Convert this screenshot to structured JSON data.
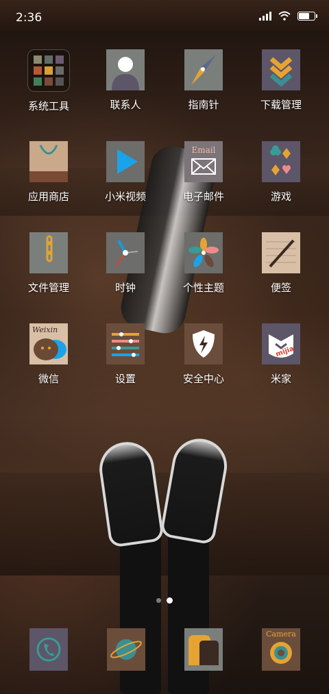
{
  "status_bar": {
    "time": "2:36"
  },
  "apps": [
    {
      "label": "系统工具",
      "icon": "folder-icon"
    },
    {
      "label": "联系人",
      "icon": "contacts-icon"
    },
    {
      "label": "指南针",
      "icon": "compass-icon"
    },
    {
      "label": "下载管理",
      "icon": "download-icon"
    },
    {
      "label": "应用商店",
      "icon": "store-bag-icon"
    },
    {
      "label": "小米视频",
      "icon": "video-play-icon"
    },
    {
      "label": "电子邮件",
      "icon": "email-icon",
      "icon_text": "Email"
    },
    {
      "label": "游戏",
      "icon": "cards-suit-icon"
    },
    {
      "label": "文件管理",
      "icon": "file-manager-icon"
    },
    {
      "label": "时钟",
      "icon": "clock-icon"
    },
    {
      "label": "个性主题",
      "icon": "pinwheel-icon"
    },
    {
      "label": "便签",
      "icon": "notes-pen-icon"
    },
    {
      "label": "微信",
      "icon": "wechat-icon",
      "icon_text": "Weixin"
    },
    {
      "label": "设置",
      "icon": "settings-sliders-icon"
    },
    {
      "label": "安全中心",
      "icon": "security-shield-icon"
    },
    {
      "label": "米家",
      "icon": "mijia-icon",
      "icon_text": "mijia"
    }
  ],
  "dock": [
    {
      "name": "phone",
      "icon": "phone-icon"
    },
    {
      "name": "browser",
      "icon": "planet-icon"
    },
    {
      "name": "gallery",
      "icon": "gallery-icon"
    },
    {
      "name": "camera",
      "icon": "camera-icon",
      "icon_text": "Camera"
    }
  ],
  "page_indicator": {
    "pages": 2,
    "active": 2
  },
  "colors": {
    "icon_gray": "#7b7f7c",
    "icon_purple": "#5d5568",
    "icon_brown": "#6b4d3c",
    "accent_blue": "#1aa3e8",
    "accent_teal": "#3a8f91",
    "accent_orange": "#e6a334"
  }
}
